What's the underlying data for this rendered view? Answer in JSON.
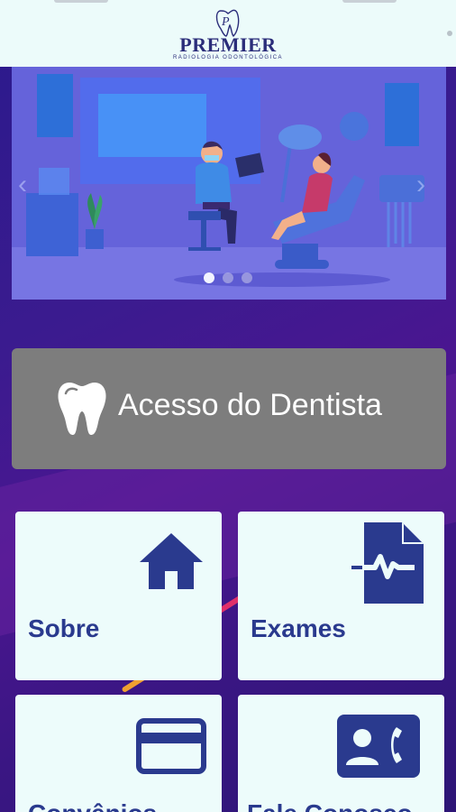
{
  "header": {
    "brand_title": "PREMIER",
    "brand_subtitle": "RADIOLOGIA ODONTOLÓGICA"
  },
  "carousel": {
    "slide_count": 3,
    "active_index": 0,
    "prev_glyph": "‹",
    "next_glyph": "›"
  },
  "dentist_access": {
    "label": "Acesso do Dentista",
    "icon": "tooth-icon"
  },
  "tiles": [
    {
      "label": "Sobre",
      "icon": "home-icon"
    },
    {
      "label": "Exames",
      "icon": "medical-report-icon"
    },
    {
      "label": "Convênios",
      "icon": "credit-card-icon"
    },
    {
      "label": "Fale Conosco",
      "icon": "contact-phone-icon"
    }
  ],
  "colors": {
    "header_bg": "#ecfbfa",
    "brand": "#2b2d7a",
    "background": "#3a1580",
    "access_button": "#7d7d7d",
    "tile_bg": "#edfcfb",
    "tile_text": "#2a3a8e"
  }
}
